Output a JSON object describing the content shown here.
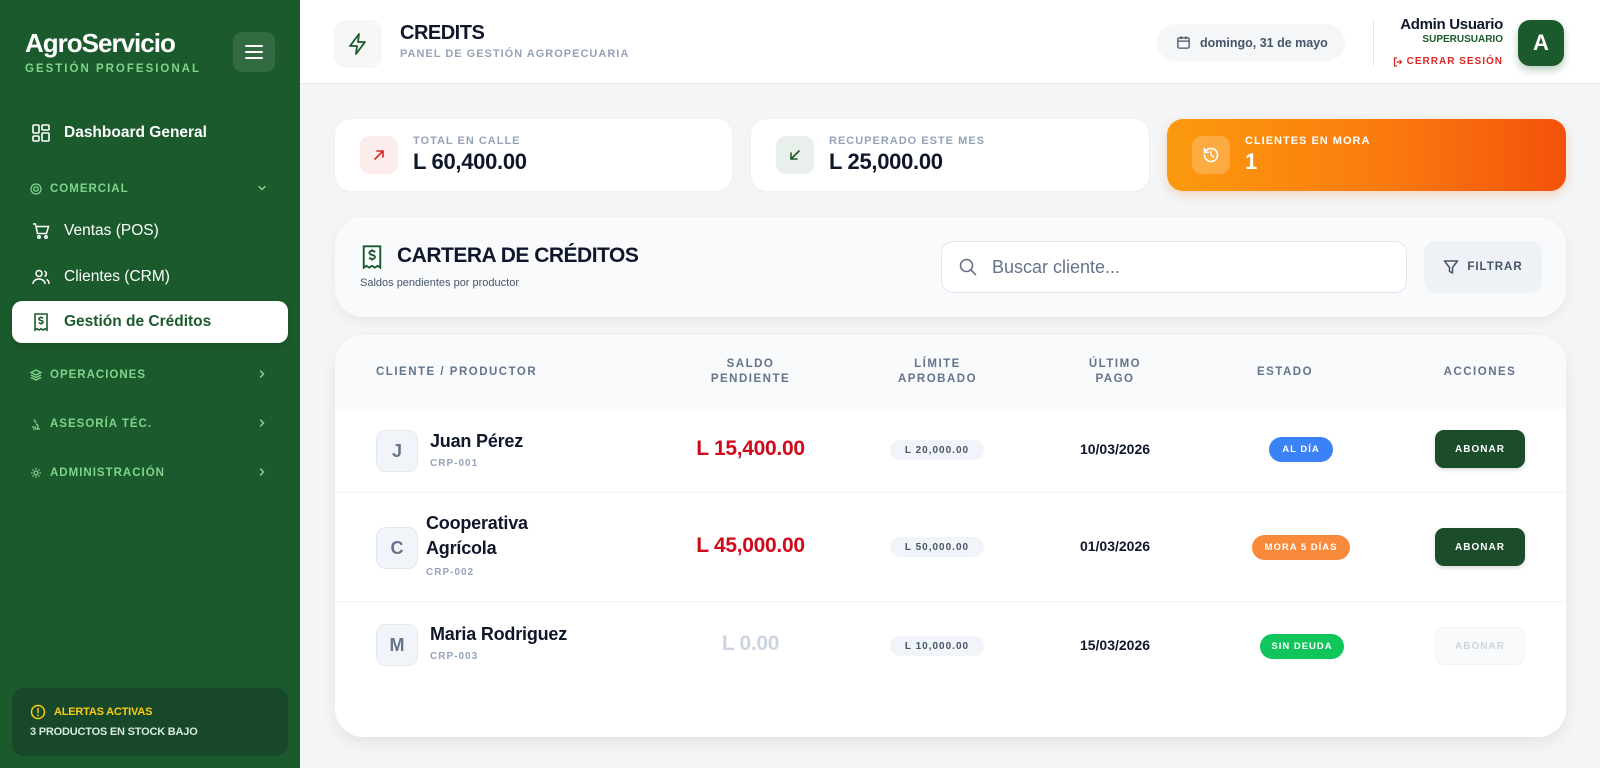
{
  "sidebar": {
    "brand_title": "AgroServicio",
    "brand_sub": "GESTIÓN PROFESIONAL",
    "dashboard": "Dashboard General",
    "section_comercial": "COMERCIAL",
    "items": [
      {
        "label": "Ventas (POS)"
      },
      {
        "label": "Clientes (CRM)"
      },
      {
        "label": "Gestión de Créditos"
      }
    ],
    "section_operaciones": "OPERACIONES",
    "section_asesoria": "ASESORÍA TÉC.",
    "section_admin": "ADMINISTRACIÓN",
    "alert_title": "ALERTAS ACTIVAS",
    "alert_text": "3 PRODUCTOS EN STOCK BAJO"
  },
  "header": {
    "title": "CREDITS",
    "subtitle": "PANEL DE GESTIÓN AGROPECUARIA",
    "date": "domingo, 31 de mayo",
    "user_name": "Admin Usuario",
    "user_role": "SUPERUSUARIO",
    "logout": "CERRAR SESIÓN",
    "avatar": "A"
  },
  "stats": {
    "total_label": "TOTAL EN CALLE",
    "total_value": "L 60,400.00",
    "recovered_label": "RECUPERADO ESTE MES",
    "recovered_value": "L 25,000.00",
    "overdue_label": "CLIENTES EN MORA",
    "overdue_value": "1"
  },
  "cartera": {
    "title": "CARTERA DE CRÉDITOS",
    "subtitle": "Saldos pendientes por productor",
    "search_placeholder": "Buscar cliente...",
    "filter_label": "FILTRAR"
  },
  "table": {
    "headers": {
      "client": "CLIENTE / PRODUCTOR",
      "balance_1": "SALDO",
      "balance_2": "PENDIENTE",
      "limit_1": "LÍMITE",
      "limit_2": "APROBADO",
      "last_1": "ÚLTIMO",
      "last_2": "PAGO",
      "status": "ESTADO",
      "actions": "ACCIONES"
    },
    "rows": [
      {
        "initial": "J",
        "name": "Juan Pérez",
        "code": "CRP-001",
        "balance": "L 15,400.00",
        "limit": "L 20,000.00",
        "last_payment": "10/03/2026",
        "status": "AL DÍA",
        "action": "ABONAR"
      },
      {
        "initial": "C",
        "name_1": "Cooperativa",
        "name_2": "Agrícola",
        "code": "CRP-002",
        "balance": "L 45,000.00",
        "limit": "L 50,000.00",
        "last_payment": "01/03/2026",
        "status": "MORA 5 DÍAS",
        "action": "ABONAR"
      },
      {
        "initial": "M",
        "name": "Maria Rodriguez",
        "code": "CRP-003",
        "balance": "L 0.00",
        "limit": "L 10,000.00",
        "last_payment": "15/03/2026",
        "status": "SIN DEUDA",
        "action": "ABONAR"
      }
    ]
  },
  "colors": {
    "sidebar_green": "#1b5a2c",
    "accent_green_text": "#7fd48c",
    "balance_red": "#d00a1c",
    "status_ok_blue": "#3b82f6",
    "status_overdue_orange": "#f98a3c",
    "status_nodebt_green": "#10c65a",
    "alert_yellow": "#facc15"
  }
}
